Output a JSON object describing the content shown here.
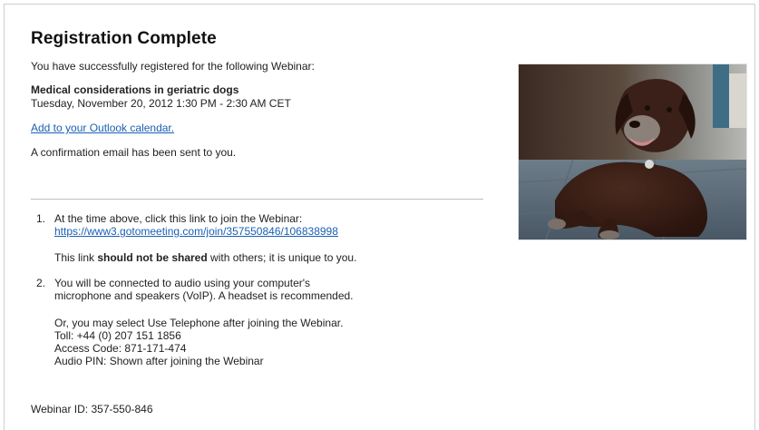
{
  "heading": "Registration Complete",
  "intro": "You have successfully registered for the following Webinar:",
  "webinar": {
    "title": "Medical considerations in geriatric dogs",
    "datetime": "Tuesday, November 20, 2012 1:30 PM - 2:30 AM CET"
  },
  "calendar_link": "Add to your Outlook calendar.",
  "confirmation": "A confirmation email has been sent to you.",
  "steps": [
    {
      "number": "1.",
      "text": "At the time above, click this link to join the Webinar:",
      "link": "https://www3.gotomeeting.com/join/357550846/106838998",
      "note_prefix": "This link ",
      "note_bold": "should not be shared",
      "note_suffix": " with others; it is unique to you."
    },
    {
      "number": "2.",
      "text_line1": "You will be connected to audio using your computer's",
      "text_line2": "microphone and speakers (VoIP). A headset is recommended.",
      "phone_intro": "Or, you may select Use Telephone after joining the Webinar.",
      "toll": "Toll: +44 (0) 207 151 1856",
      "access_code": "Access Code: 871-171-474",
      "audio_pin": "Audio PIN: Shown after joining the Webinar"
    }
  ],
  "webinar_id": "Webinar ID: 357-550-846",
  "photo": {
    "subject": "dog-photo"
  },
  "colors": {
    "link": "#1a5fb4",
    "divider": "#bdbdbd",
    "text": "#222222"
  }
}
